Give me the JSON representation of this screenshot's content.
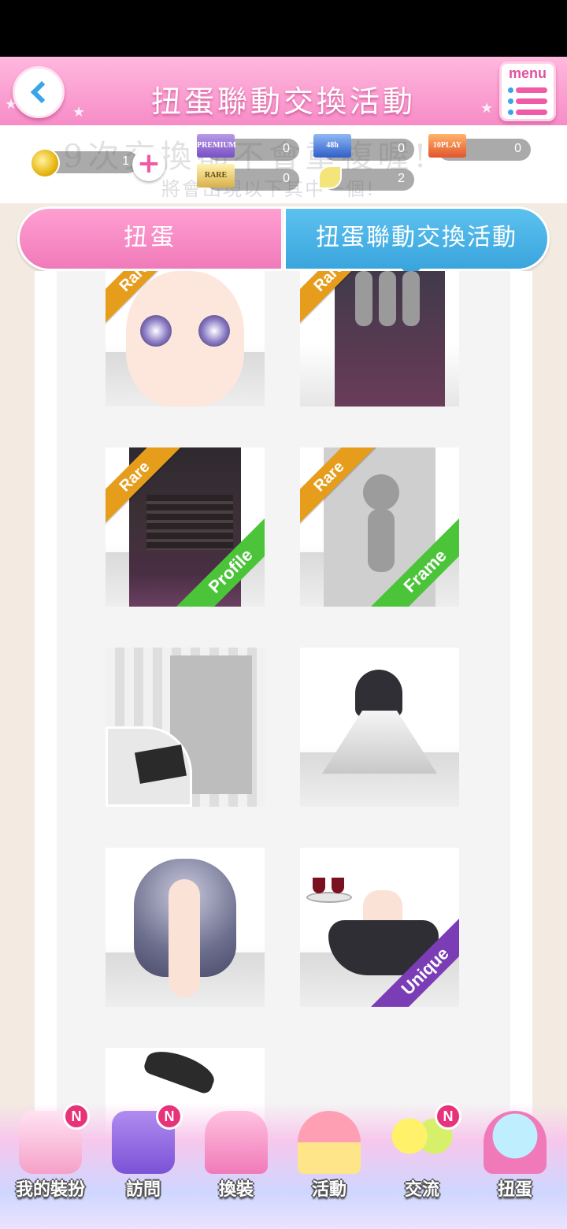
{
  "header": {
    "title": "扭蛋聯動交換活動",
    "menu_label": "menu"
  },
  "currency": {
    "coins": "1",
    "premium_tickets": "0",
    "premium_label": "PREMIUM",
    "ticket_48h": "0",
    "ticket_48h_label": "48h",
    "ticket_10play": "0",
    "ticket_10play_label": "10PLAY",
    "rare_tickets": "0",
    "rare_label": "RARE",
    "leaf_items": "2"
  },
  "notice": {
    "line1": "9次交換都不會重複喔!",
    "line2": "將會出現以下其中一個!"
  },
  "tabs": [
    {
      "label": "扭蛋"
    },
    {
      "label": "扭蛋聯動交換活動"
    }
  ],
  "items": [
    {
      "label": "",
      "badge": "Rare",
      "corner": ""
    },
    {
      "label": "",
      "badge": "Rare",
      "corner": ""
    },
    {
      "label": "",
      "badge": "Rare",
      "corner": "Profile"
    },
    {
      "label": "",
      "badge": "Rare",
      "corner": "Frame"
    },
    {
      "label": "",
      "badge": "",
      "corner": ""
    },
    {
      "label": "",
      "badge": "",
      "corner": ""
    },
    {
      "label": "",
      "badge": "",
      "corner": ""
    },
    {
      "label": "",
      "badge": "",
      "corner": "Unique"
    },
    {
      "label": "",
      "badge": "",
      "corner": ""
    }
  ],
  "bottom_nav": [
    {
      "label": "我的裝扮",
      "badge": "N"
    },
    {
      "label": "訪問",
      "badge": "N"
    },
    {
      "label": "換裝",
      "badge": ""
    },
    {
      "label": "活動",
      "badge": ""
    },
    {
      "label": "交流",
      "badge": "N"
    },
    {
      "label": "扭蛋",
      "badge": ""
    }
  ],
  "colors": {
    "header_pink": "#f78cc7",
    "tab_blue": "#3aa5dd",
    "rare_ribbon": "#e69d1c",
    "profile_frame_badge": "#4cc43a",
    "unique_badge": "#7b3db5",
    "notification": "#e6337a"
  }
}
